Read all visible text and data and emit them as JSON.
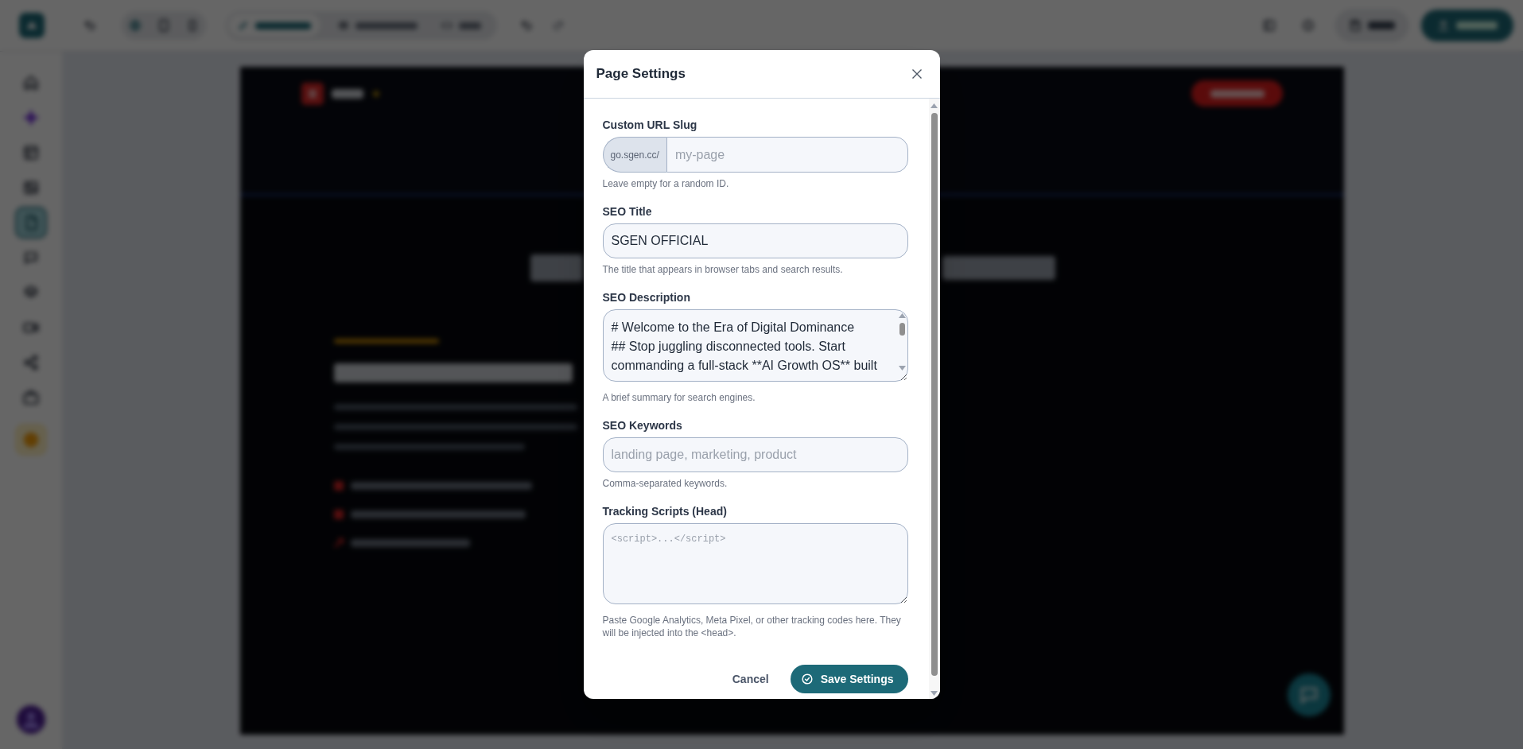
{
  "app": {
    "toolbar": {
      "modes": [
        {
          "selected": true
        },
        {
          "selected": false
        },
        {
          "selected": false
        }
      ]
    },
    "sidebar": {
      "items": [
        {
          "kind": "nav",
          "selected": false
        },
        {
          "kind": "nav",
          "selected": false
        },
        {
          "kind": "nav",
          "selected": false
        },
        {
          "kind": "nav",
          "selected": false
        },
        {
          "kind": "nav",
          "selected": true
        },
        {
          "kind": "nav",
          "selected": false
        },
        {
          "kind": "nav",
          "selected": false
        },
        {
          "kind": "nav",
          "selected": false
        },
        {
          "kind": "nav",
          "selected": false
        },
        {
          "kind": "nav",
          "selected": false
        },
        {
          "kind": "upgrade",
          "selected": false
        }
      ]
    }
  },
  "dialog": {
    "title": "Page Settings",
    "fields": [
      {
        "kind": "slug",
        "label": "Custom URL Slug",
        "prefix": "go.sgen.cc/",
        "placeholder": "my-page",
        "hint": "Leave empty for a random ID."
      },
      {
        "kind": "text",
        "label": "SEO Title",
        "value": "SGEN OFFICIAL",
        "hint": "The title that appears in browser tabs and search results."
      },
      {
        "kind": "textarea",
        "label": "SEO Description",
        "value": "# Welcome to the Era of Digital Dominance\n## Stop juggling disconnected tools. Start\ncommanding a full-stack **AI Growth OS** built",
        "hint": "A brief summary for search engines."
      },
      {
        "kind": "text",
        "label": "SEO Keywords",
        "placeholder": "landing page, marketing, product",
        "hint": "Comma-separated keywords."
      },
      {
        "kind": "code",
        "label": "Tracking Scripts (Head)",
        "placeholder": "<script>...</script>",
        "hint": "Paste Google Analytics, Meta Pixel, or other tracking codes here. They will be injected into the <head>."
      }
    ],
    "buttons": [
      {
        "kind": "secondary",
        "label": "Cancel"
      },
      {
        "kind": "primary",
        "label": "Save Settings"
      }
    ]
  }
}
